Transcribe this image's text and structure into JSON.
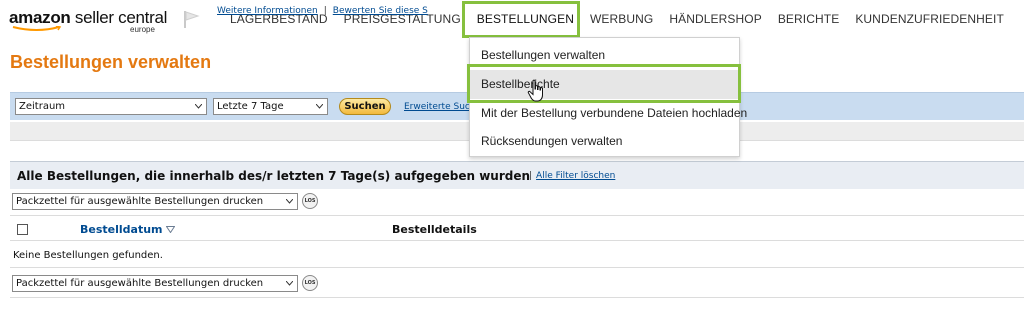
{
  "brand": {
    "name_bold": "amazon",
    "name_rest": " seller central",
    "region": "europe"
  },
  "nav": {
    "items": [
      {
        "label": "LAGERBESTAND"
      },
      {
        "label": "PREISGESTALTUNG"
      },
      {
        "label": "BESTELLUNGEN"
      },
      {
        "label": "WERBUNG"
      },
      {
        "label": "HÄNDLERSHOP"
      },
      {
        "label": "BERICHTE"
      },
      {
        "label": "KUNDENZUFRIEDENHEIT"
      }
    ],
    "active": "BESTELLUNGEN"
  },
  "dropdown": {
    "items": [
      {
        "label": "Bestellungen verwalten"
      },
      {
        "label": "Bestellberichte"
      },
      {
        "label": "Mit der Bestellung verbundene Dateien hochladen"
      },
      {
        "label": "Rücksendungen verwalten"
      }
    ],
    "hovered": "Bestellberichte"
  },
  "page": {
    "title": "Bestellungen verwalten",
    "link_info": "Weitere Informationen",
    "link_rate": "Bewerten Sie diese S"
  },
  "search": {
    "range_select": "Zeitraum",
    "period_select": "Letzte 7 Tage",
    "button": "Suchen",
    "advanced_link": "Erweiterte Such"
  },
  "orders": {
    "heading": "Alle Bestellungen, die innerhalb des/r letzten 7 Tage(s) aufgegeben wurden",
    "separator": "|",
    "clear_filters": "Alle Filter löschen",
    "action_select": "Packzettel für ausgewählte Bestellungen drucken",
    "go_button": "LOS",
    "col_date": "Bestelldatum",
    "col_details": "Bestelldetails",
    "empty_message": "Keine Bestellungen gefunden."
  },
  "colors": {
    "accent_orange": "#e47911",
    "link_blue": "#004b91",
    "highlight_green": "#86c03e",
    "search_bar_blue": "#c9dcf0"
  }
}
